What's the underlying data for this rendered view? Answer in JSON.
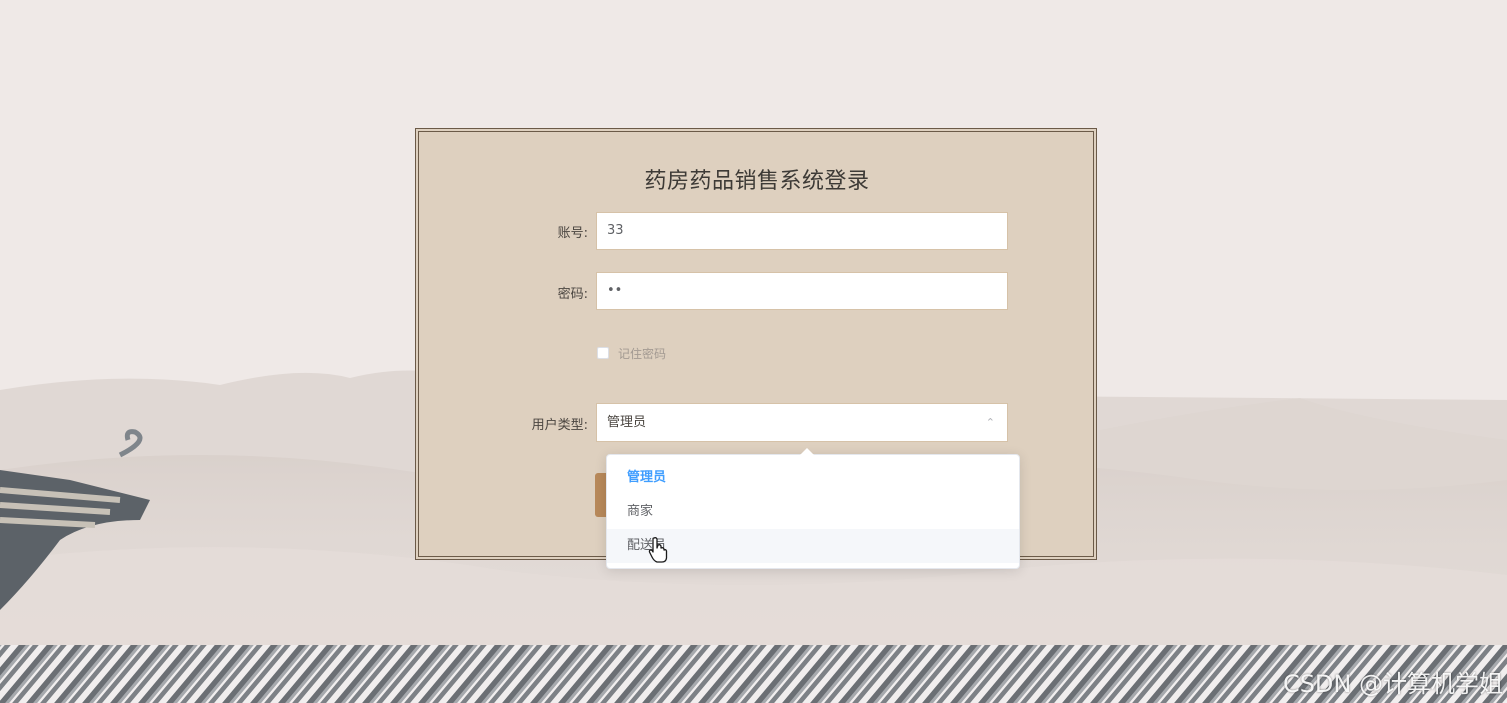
{
  "login": {
    "title": "药房药品销售系统登录",
    "account_label": "账号:",
    "account_value": "33",
    "password_label": "密码:",
    "password_value": "••",
    "remember_label": "记住密码",
    "user_type_label": "用户类型:",
    "user_type_value": "管理员"
  },
  "dropdown": {
    "options": [
      "管理员",
      "商家",
      "配送员"
    ],
    "selected_index": 0,
    "hover_index": 2
  },
  "watermark": "CSDN @计算机学姐",
  "colors": {
    "background": "#efe9e7",
    "panel": "#ded0bf",
    "accent": "#409eff",
    "button": "#b8895a"
  },
  "icons": {
    "select_arrow": "chevron-up-icon",
    "cursor": "hand-pointer-icon"
  }
}
